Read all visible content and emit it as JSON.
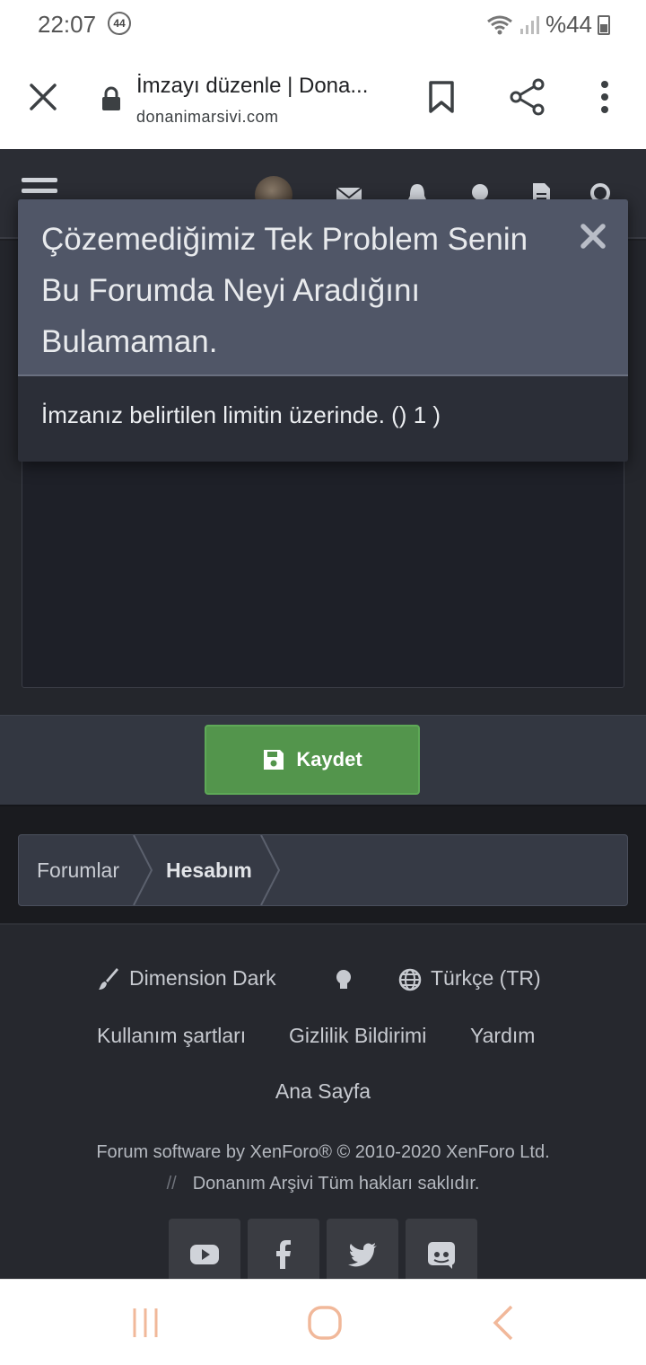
{
  "status_bar": {
    "time": "22:07",
    "badge": "44",
    "battery": "%44"
  },
  "browser": {
    "page_title": "İmzayı düzenle | Dona...",
    "domain": "donanimarsivi.com"
  },
  "modal": {
    "title": "Çözemediğimiz Tek Problem Senin Bu Forumda Neyi Aradığını Bulamaman.",
    "message": "İmzanız belirtilen limitin üzerinde. () 1 )"
  },
  "form": {
    "save_label": "Kaydet"
  },
  "breadcrumb": {
    "items": [
      "Forumlar",
      "Hesabım"
    ]
  },
  "footer": {
    "style_chooser": "Dimension Dark",
    "language": "Türkçe (TR)",
    "links": [
      "Kullanım şartları",
      "Gizlilik Bildirimi",
      "Yardım"
    ],
    "home_link": "Ana Sayfa",
    "copyright_line1": "Forum software by XenForo® © 2010-2020 XenForo Ltd.",
    "copyright_sep": "//",
    "copyright_line2": "Donanım Arşivi Tüm hakları saklıdır.",
    "social_icons": [
      "youtube-icon",
      "facebook-icon",
      "twitter-icon",
      "discord-icon"
    ]
  },
  "colors": {
    "save_button": "#53954c",
    "modal_header": "#505667",
    "modal_body": "#2b2e37",
    "page_bg": "#1f2025"
  }
}
